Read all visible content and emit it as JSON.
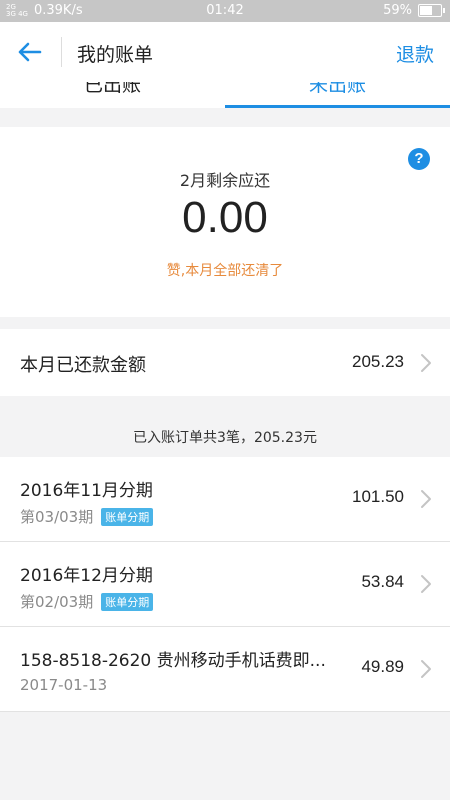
{
  "status_bar": {
    "signal_top": "2G",
    "signal_bottom": "3G 4G",
    "net_speed": "0.39K/s",
    "time": "01:42",
    "battery": "59%",
    "battery_level": 0.59
  },
  "header": {
    "title": "我的账单",
    "action": "退款"
  },
  "tabs": [
    {
      "label": "已出账"
    },
    {
      "label": "未出账",
      "active": true
    }
  ],
  "summary": {
    "label": "2月剩余应还",
    "amount": "0.00",
    "note": "赞,本月全部还清了",
    "help_icon": "question-icon"
  },
  "repaid": {
    "label": "本月已还款金额",
    "amount": "205.23"
  },
  "bills_header": "已入账订单共3笔，205.23元",
  "bills": [
    {
      "title": "2016年11月分期",
      "sub": "第03/03期",
      "tag": "账单分期",
      "amount": "101.50"
    },
    {
      "title": "2016年12月分期",
      "sub": "第02/03期",
      "tag": "账单分期",
      "amount": "53.84"
    },
    {
      "title": "158-8518-2620 贵州移动手机话费即...",
      "sub": "2017-01-13",
      "tag": "",
      "amount": "49.89"
    }
  ],
  "colors": {
    "accent": "#1e8ee3",
    "note": "#e78a3c",
    "tag": "#4ab4e8"
  }
}
